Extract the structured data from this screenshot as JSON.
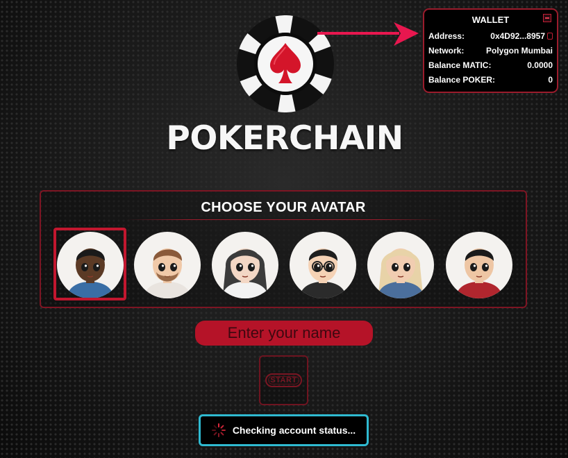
{
  "brand": {
    "name": "POKERCHAIN"
  },
  "wallet": {
    "title": "WALLET",
    "rows": [
      {
        "label": "Address:",
        "value": "0x4D92...8957"
      },
      {
        "label": "Network:",
        "value": "Polygon Mumbai"
      },
      {
        "label": "Balance MATIC:",
        "value": "0.0000"
      },
      {
        "label": "Balance POKER:",
        "value": "0"
      }
    ]
  },
  "avatar_section": {
    "title": "CHOOSE YOUR AVATAR",
    "selected_index": 0,
    "avatars": [
      {
        "skin": "#5b3a25",
        "hair": "#1a1a1a",
        "shirt": "#3a6ea5",
        "style": "short"
      },
      {
        "skin": "#f0c9a8",
        "hair": "#8a5a3a",
        "shirt": "#e9e4df",
        "style": "beard"
      },
      {
        "skin": "#f3d7c5",
        "hair": "#3b3b3b",
        "shirt": "#f2f2f2",
        "style": "long"
      },
      {
        "skin": "#f5d2b5",
        "hair": "#1e1e1e",
        "shirt": "#2b2b2b",
        "style": "glasses"
      },
      {
        "skin": "#f1cdb1",
        "hair": "#e8d3a8",
        "shirt": "#4b6f9c",
        "style": "blonde"
      },
      {
        "skin": "#eec6a4",
        "hair": "#1a1a1a",
        "shirt": "#b0262e",
        "style": "short"
      }
    ]
  },
  "name_input": {
    "placeholder": "Enter your name",
    "value": ""
  },
  "start": {
    "label": "START"
  },
  "status": {
    "text": "Checking account status..."
  },
  "colors": {
    "accent": "#c2172f",
    "status_border": "#2fbad1",
    "panel_border": "#7d1523"
  }
}
